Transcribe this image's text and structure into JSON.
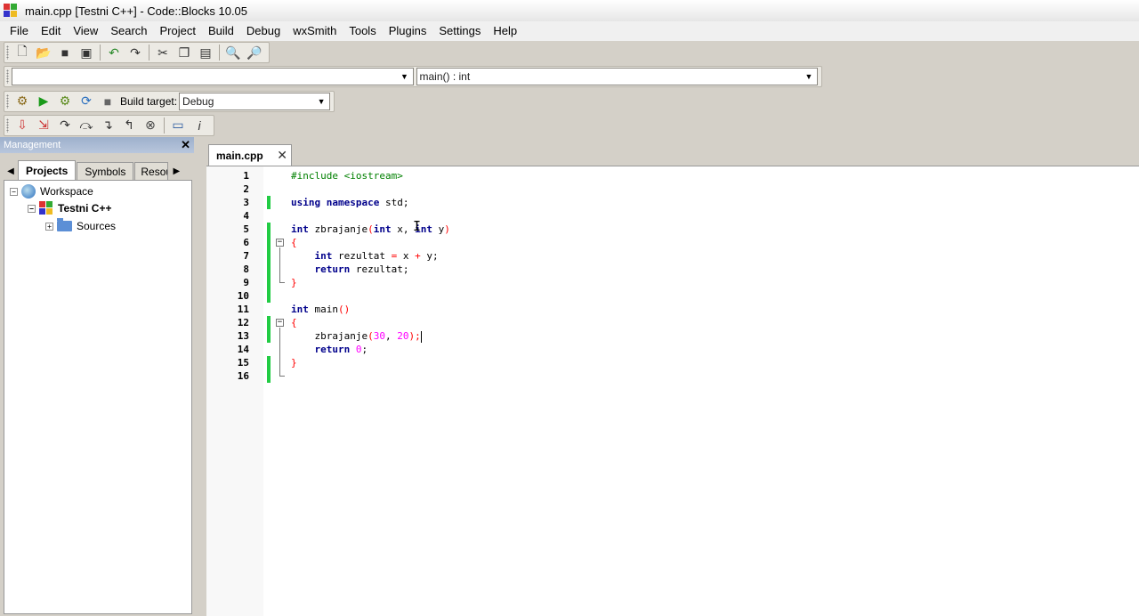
{
  "window": {
    "title": "main.cpp [Testni C++] - Code::Blocks 10.05"
  },
  "menu": [
    "File",
    "Edit",
    "View",
    "Search",
    "Project",
    "Build",
    "Debug",
    "wxSmith",
    "Tools",
    "Plugins",
    "Settings",
    "Help"
  ],
  "toolbar": {
    "scope_combo_value": "",
    "function_combo_value": "main() : int",
    "build_target_label": "Build target:",
    "build_target_value": "Debug"
  },
  "management": {
    "title": "Management",
    "tabs": [
      "Projects",
      "Symbols",
      "Resou"
    ],
    "tree": {
      "workspace": "Workspace",
      "project": "Testni C++",
      "sources": "Sources"
    }
  },
  "editor": {
    "tab_label": "main.cpp",
    "line_numbers": [
      "1",
      "2",
      "3",
      "4",
      "5",
      "6",
      "7",
      "8",
      "9",
      "10",
      "11",
      "12",
      "13",
      "14",
      "15",
      "16"
    ],
    "code": {
      "l1": "#include <iostream>",
      "l3_kw1": "using",
      "l3_kw2": "namespace",
      "l3_rest": " std;",
      "l5_kw1": "int",
      "l5_fn": " zbrajanje",
      "l5_open": "(",
      "l5_kw2": "int",
      "l5_x": " x, ",
      "l5_kw3": "int",
      "l5_y": " y",
      "l5_close": ")",
      "l6": "{",
      "l7_kw": "int",
      "l7_rest1": " rezultat ",
      "l7_eq": "=",
      "l7_rest2": " x ",
      "l7_plus": "+",
      "l7_rest3": " y;",
      "l8_kw": "return",
      "l8_rest": " rezultat;",
      "l9": "}",
      "l11_kw": "int",
      "l11_fn": " main",
      "l11_paren": "()",
      "l12": "{",
      "l13_fn": "zbrajanje",
      "l13_open": "(",
      "l13_n1": "30",
      "l13_comma": ", ",
      "l13_n2": "20",
      "l13_close": ");",
      "l14_kw": "return",
      "l14_n": " 0",
      "l14_semi": ";",
      "l15": "}"
    }
  }
}
